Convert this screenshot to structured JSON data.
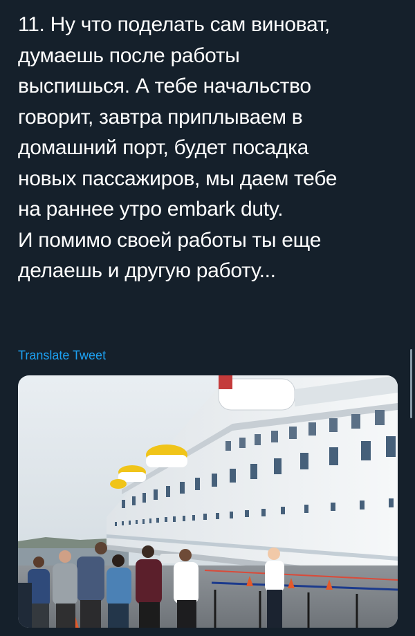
{
  "tweet": {
    "lines": [
      "11. Ну что поделать сам виноват,",
      "думаешь после работы",
      "выспишься. А тебе начальство",
      "говорит, завтра приплываем в",
      "домашний порт, будет посадка",
      "новых пассажиров, мы даем тебе",
      "на раннее утро embark duty.",
      "И помимо своей работы ты еще",
      "делаешь и другую работу..."
    ],
    "translate_label": "Translate Tweet"
  },
  "media": {
    "description_icon": "photo-icon"
  },
  "colors": {
    "background": "#15202b",
    "text": "#ffffff",
    "link": "#1da1f2"
  }
}
